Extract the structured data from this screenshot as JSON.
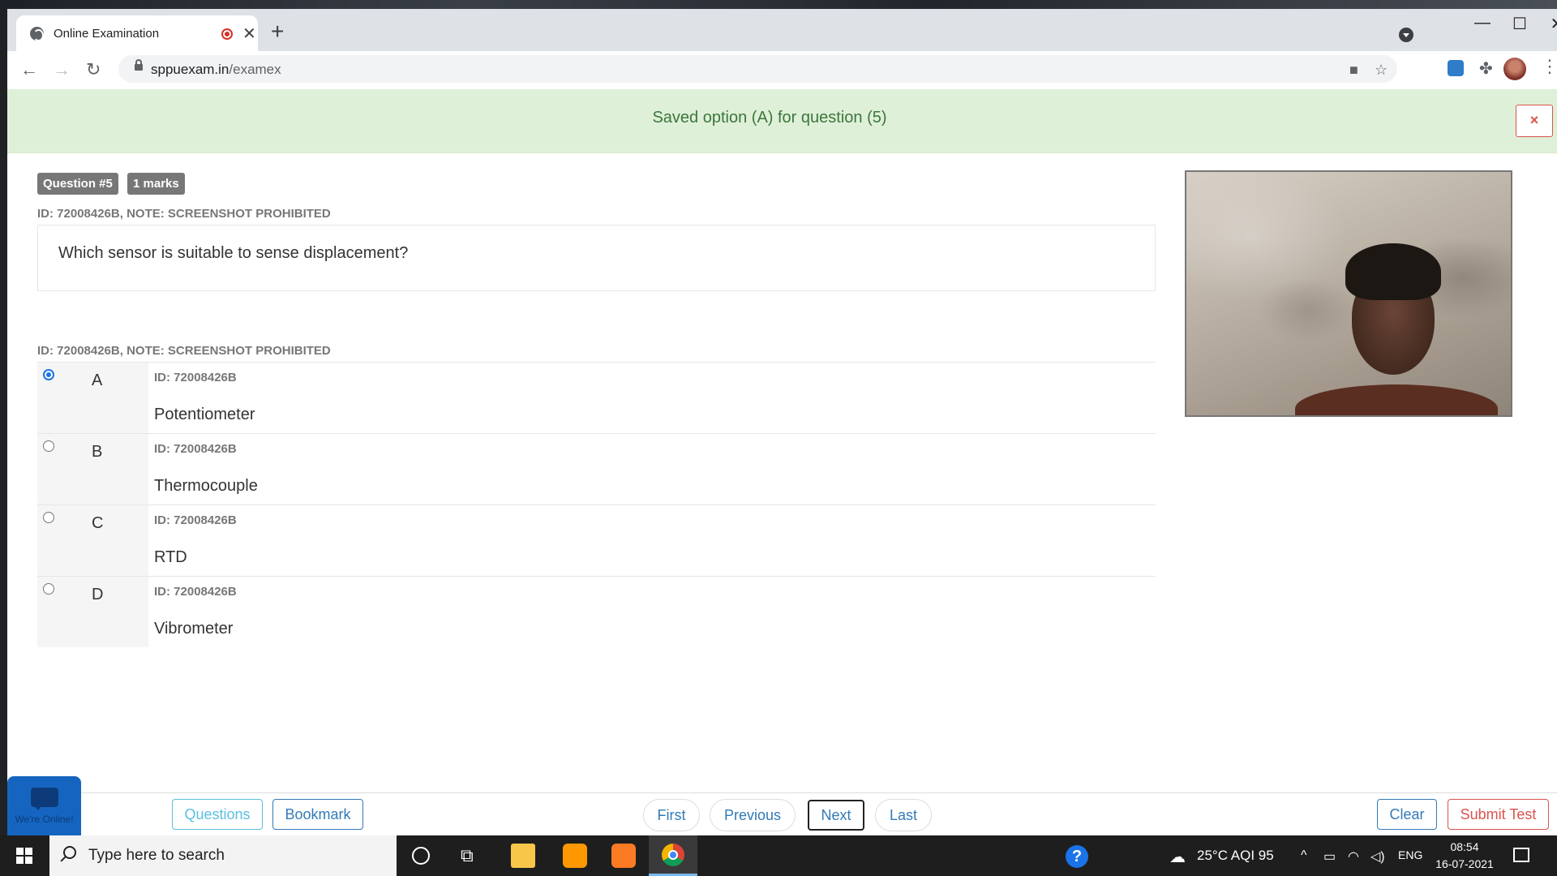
{
  "browser": {
    "tab_title": "Online Examination",
    "url_host": "sppuexam.in",
    "url_path": "/examex"
  },
  "alert": {
    "message": "Saved option (A) for question (5)",
    "close_label": "×"
  },
  "question": {
    "number_badge": "Question #5",
    "marks_badge": "1 marks",
    "note_top": "ID: 72008426B, NOTE: SCREENSHOT PROHIBITED",
    "text": "Which sensor is suitable to sense displacement?",
    "note_options": "ID: 72008426B, NOTE: SCREENSHOT PROHIBITED"
  },
  "options": [
    {
      "letter": "A",
      "id": "ID: 72008426B",
      "text": "Potentiometer",
      "selected": true
    },
    {
      "letter": "B",
      "id": "ID: 72008426B",
      "text": "Thermocouple",
      "selected": false
    },
    {
      "letter": "C",
      "id": "ID: 72008426B",
      "text": "RTD",
      "selected": false
    },
    {
      "letter": "D",
      "id": "ID: 72008426B",
      "text": "Vibrometer",
      "selected": false
    }
  ],
  "footer": {
    "questions_label": "Questions",
    "bookmark_label": "Bookmark",
    "first_label": "First",
    "previous_label": "Previous",
    "next_label": "Next",
    "last_label": "Last",
    "clear_label": "Clear",
    "submit_label": "Submit Test",
    "chat_label": "We're Online!"
  },
  "taskbar": {
    "search_placeholder": "Type here to search",
    "weather": "25°C  AQI 95",
    "language": "ENG",
    "time": "08:54",
    "date": "16-07-2021"
  },
  "colors": {
    "alert_bg": "#dff0d8",
    "alert_text": "#3c763d",
    "primary": "#337ab7",
    "info": "#5bc0de",
    "danger": "#d9534f",
    "badge": "#777777"
  }
}
